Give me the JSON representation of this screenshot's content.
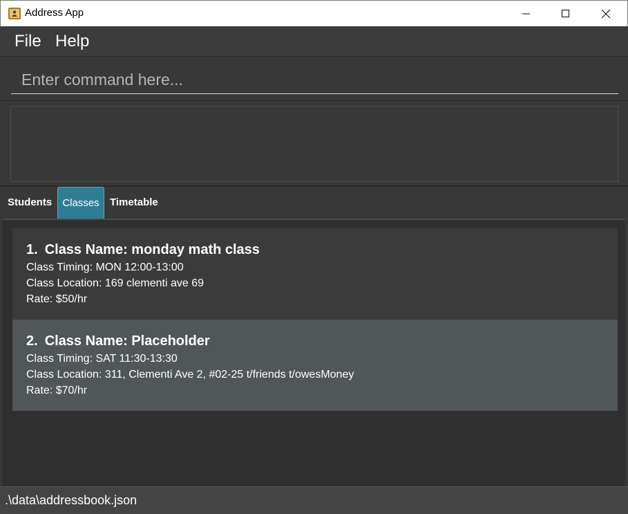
{
  "window": {
    "title": "Address App",
    "app_icon": "address-book-icon"
  },
  "menu": {
    "items": [
      {
        "label": "File"
      },
      {
        "label": "Help"
      }
    ]
  },
  "command": {
    "placeholder": "Enter command here...",
    "value": ""
  },
  "result": {
    "text": ""
  },
  "tabs": [
    {
      "label": "Students",
      "selected": false
    },
    {
      "label": "Classes",
      "selected": true
    },
    {
      "label": "Timetable",
      "selected": false
    }
  ],
  "classes": [
    {
      "index": "1.",
      "name": "Class Name: monday math class",
      "timing": "Class Timing: MON 12:00-13:00",
      "location": "Class Location: 169 clementi ave 69",
      "rate": "Rate: $50/hr"
    },
    {
      "index": "2.",
      "name": "Class Name: Placeholder",
      "timing": "Class Timing: SAT 11:30-13:30",
      "location": "Class Location: 311, Clementi Ave 2, #02-25 t/friends t/owesMoney",
      "rate": "Rate: $70/hr"
    }
  ],
  "status": {
    "path": ".\\data\\addressbook.json"
  },
  "colors": {
    "accent": "#2f7d95",
    "background": "#383838",
    "selected_card": "#515658"
  }
}
